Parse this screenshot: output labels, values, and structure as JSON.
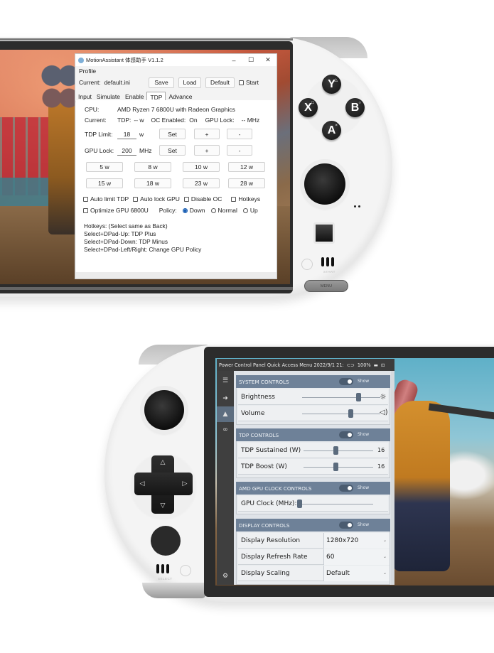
{
  "top_device": {
    "app_window": {
      "title": "MotionAssistant 体感助手 V1.1.2",
      "window_controls": {
        "minimize": "–",
        "maximize": "☐",
        "close": "✕"
      },
      "profile": {
        "section_label": "Profile",
        "current_label": "Current:",
        "current_value": "default.ini",
        "save_label": "Save",
        "load_label": "Load",
        "default_label": "Default",
        "start_label": "Start",
        "start_checked": false
      },
      "tabs": [
        {
          "label": "Input",
          "active": false
        },
        {
          "label": "Simulate",
          "active": false
        },
        {
          "label": "Enable",
          "active": false
        },
        {
          "label": "TDP",
          "active": true
        },
        {
          "label": "Advance",
          "active": false
        }
      ],
      "tdp_panel": {
        "cpu_label": "CPU:",
        "cpu_value": "AMD Ryzen 7 6800U with Radeon Graphics",
        "current_label": "Current:",
        "tdp_label": "TDP:",
        "tdp_value": "-- w",
        "oc_label": "OC Enabled:",
        "oc_value": "On",
        "gpu_lock_status_label": "GPU Lock:",
        "gpu_lock_status_value": "-- MHz",
        "tdp_limit_label": "TDP Limit:",
        "tdp_limit_value": "18",
        "tdp_limit_unit": "w",
        "gpu_lock_label": "GPU Lock:",
        "gpu_lock_value": "200",
        "gpu_lock_unit": "MHz",
        "set_label": "Set",
        "plus_label": "+",
        "minus_label": "-",
        "presets": [
          "5 w",
          "8 w",
          "10 w",
          "12 w",
          "15 w",
          "18 w",
          "23 w",
          "28 w"
        ],
        "checkboxes": [
          {
            "label": "Auto limit TDP",
            "checked": false
          },
          {
            "label": "Auto lock GPU",
            "checked": false
          },
          {
            "label": "Disable OC",
            "checked": false
          },
          {
            "label": "Hotkeys",
            "checked": false
          },
          {
            "label": "Optimize GPU 6800U",
            "checked": false
          }
        ],
        "policy_label": "Policy:",
        "policy_options": [
          {
            "label": "Down",
            "selected": true
          },
          {
            "label": "Normal",
            "selected": false
          },
          {
            "label": "Up",
            "selected": false
          }
        ],
        "hotkeys_lines": [
          "Hotkeys:  (Select same as Back)",
          "Select+DPad-Up:  TDP Plus",
          "Select+DPad-Down:  TDP Minus",
          "Select+DPad-Left/Right: Change GPU Policy"
        ]
      }
    },
    "face_buttons": [
      {
        "letter": "Y",
        "symbol": "△"
      },
      {
        "letter": "X",
        "symbol": "□"
      },
      {
        "letter": "B",
        "symbol": "○"
      },
      {
        "letter": "A",
        "symbol": "×"
      }
    ],
    "start_label": "START",
    "menu_label": "MENU"
  },
  "bottom_device": {
    "overlay": {
      "title_bar": "Power Control Panel Quick Access Menu 2022/9/1 21:",
      "battery": "100%",
      "sections": [
        {
          "title": "SYSTEM CONTROLS",
          "toggle_label": "Show",
          "toggle_on": true,
          "sliders": [
            {
              "label": "Brightness",
              "value_fraction": 0.72,
              "icon": "sun-icon"
            },
            {
              "label": "Volume",
              "value_fraction": 0.62,
              "icon": "speaker-icon"
            }
          ]
        },
        {
          "title": "TDP CONTROLS",
          "toggle_label": "Show",
          "toggle_on": true,
          "sliders": [
            {
              "label": "TDP Sustained (W)",
              "value": "16",
              "value_fraction": 0.46
            },
            {
              "label": "TDP Boost (W)",
              "value": "16",
              "value_fraction": 0.46
            }
          ]
        },
        {
          "title": "AMD GPU CLOCK CONTROLS",
          "toggle_label": "Show",
          "toggle_on": true,
          "sliders": [
            {
              "label": "GPU Clock (MHz):",
              "value_fraction": 0.0
            }
          ]
        },
        {
          "title": "DISPLAY CONTROLS",
          "toggle_label": "Show",
          "toggle_on": true,
          "dropdowns": [
            {
              "label": "Display Resolution",
              "value": "1280x720"
            },
            {
              "label": "Display Refresh Rate",
              "value": "60"
            },
            {
              "label": "Display Scaling",
              "value": "Default"
            }
          ]
        }
      ],
      "sidebar_icons": [
        "menu-icon",
        "exit-icon",
        "home-icon",
        "gamepad-icon",
        "gear-icon"
      ]
    },
    "select_label": "SELECT"
  }
}
